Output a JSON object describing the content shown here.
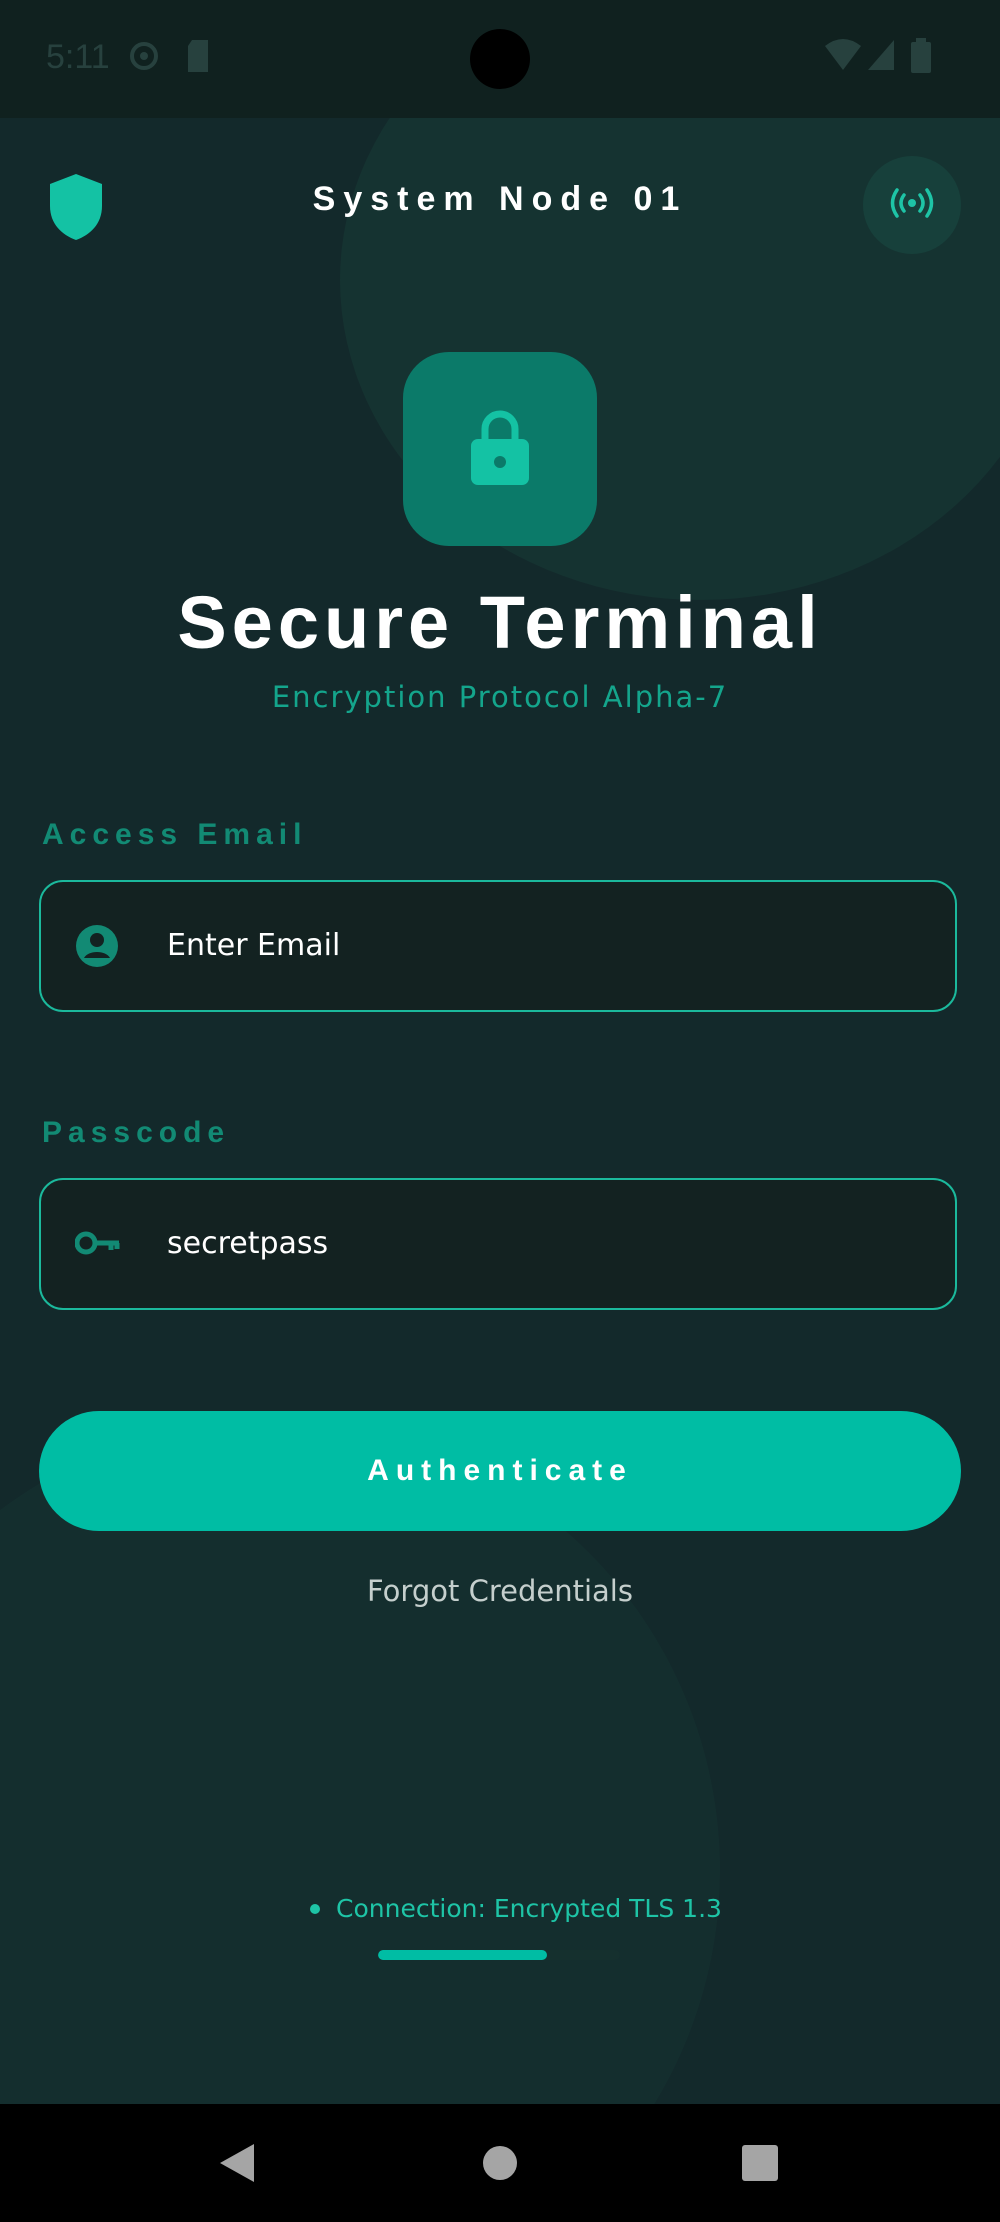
{
  "status_bar": {
    "time": "5:11"
  },
  "header": {
    "title": "System Node 01",
    "left_icon": "shield-icon",
    "right_icon": "broadcast-icon"
  },
  "hero": {
    "icon": "lock-icon",
    "title": "Secure Terminal",
    "subtitle": "Encryption Protocol Alpha-7"
  },
  "form": {
    "email": {
      "label": "Access Email",
      "placeholder": "Enter Email",
      "icon": "account-circle-icon"
    },
    "passcode": {
      "label": "Passcode",
      "value": "secretpass",
      "icon": "key-icon"
    },
    "submit_label": "Authenticate",
    "forgot_label": "Forgot Credentials"
  },
  "footer": {
    "connection_text": "Connection: Encrypted TLS 1.3",
    "progress": 0.7
  },
  "colors": {
    "background": "#13292b",
    "accent": "#00bda4",
    "accent_dark": "#0b7a69",
    "label": "#128a74"
  }
}
